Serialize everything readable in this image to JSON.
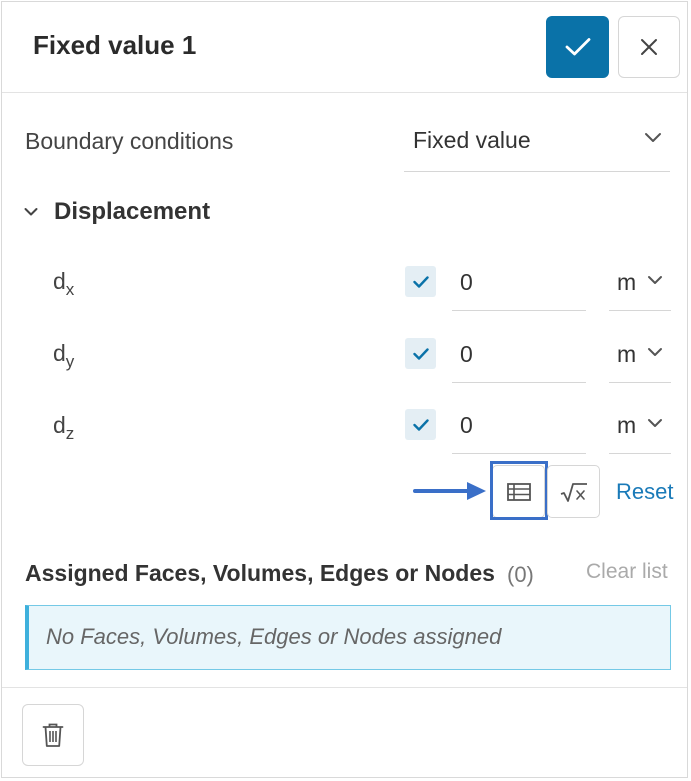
{
  "panel": {
    "title": "Fixed value 1",
    "confirm_icon": "checkmark-icon",
    "close_icon": "close-icon"
  },
  "boundary": {
    "label": "Boundary conditions",
    "value": "Fixed value"
  },
  "displacement": {
    "section_title": "Displacement",
    "rows": [
      {
        "base": "d",
        "sub": "x",
        "checked": true,
        "value": "0",
        "unit": "m"
      },
      {
        "base": "d",
        "sub": "y",
        "checked": true,
        "value": "0",
        "unit": "m"
      },
      {
        "base": "d",
        "sub": "z",
        "checked": true,
        "value": "0",
        "unit": "m"
      }
    ],
    "table_icon": "table-icon",
    "formula_icon": "sqrt-x-icon",
    "reset_label": "Reset"
  },
  "assigned": {
    "title": "Assigned Faces, Volumes, Edges or Nodes",
    "count": "(0)",
    "clear_label": "Clear list",
    "empty_message": "No Faces, Volumes, Edges or Nodes assigned"
  },
  "footer": {
    "delete_icon": "trash-icon"
  },
  "colors": {
    "accent": "#0a72a8",
    "highlight": "#3a6fc8",
    "info_bg": "#e9f6fb",
    "info_border": "#3eb0dc"
  }
}
